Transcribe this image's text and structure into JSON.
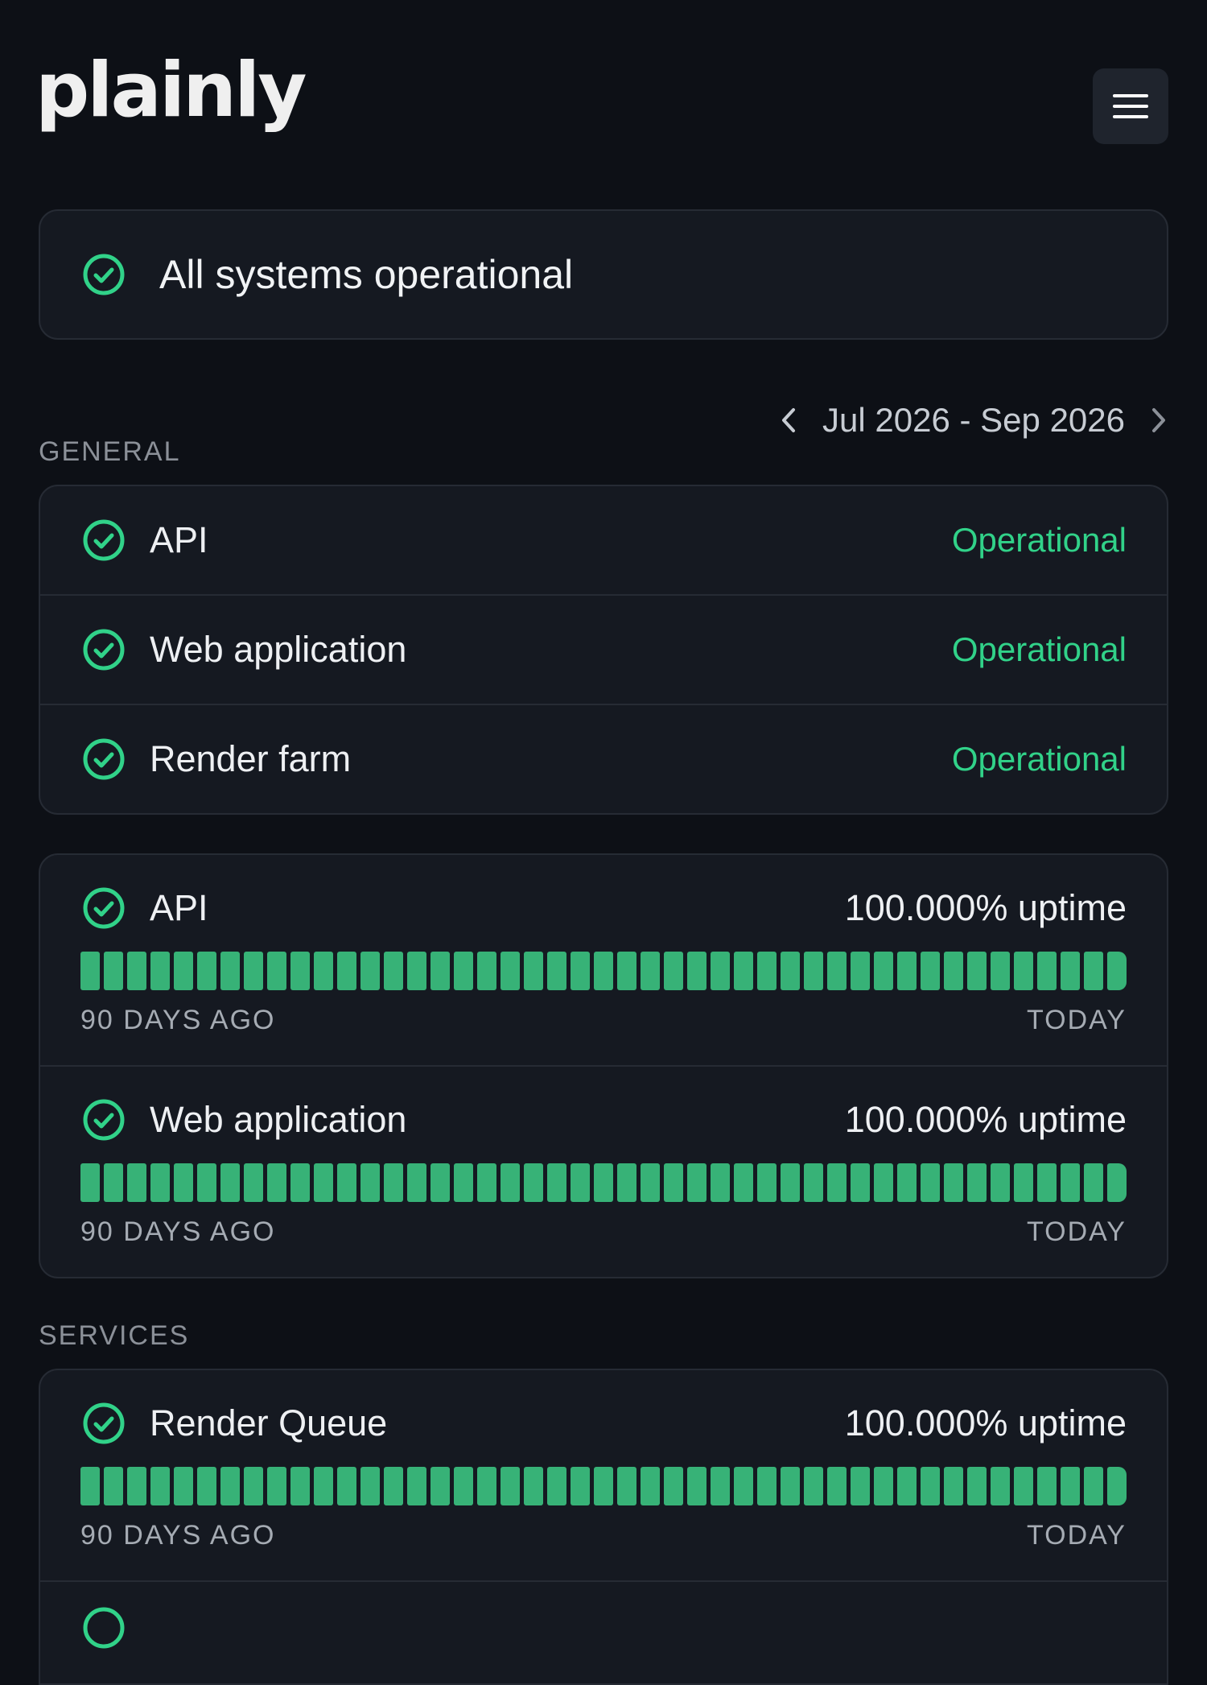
{
  "brand": {
    "logo_text": "plainly"
  },
  "banner": {
    "text": "All systems operational"
  },
  "date_range": {
    "label": "Jul 2026 - Sep 2026"
  },
  "sections": {
    "general_label": "GENERAL",
    "services_label": "SERVICES"
  },
  "general_components": [
    {
      "name": "API",
      "status": "Operational"
    },
    {
      "name": "Web application",
      "status": "Operational"
    },
    {
      "name": "Render farm",
      "status": "Operational"
    }
  ],
  "general_uptime": [
    {
      "name": "API",
      "uptime": "100.000% uptime",
      "start_label": "90 DAYS AGO",
      "end_label": "TODAY"
    },
    {
      "name": "Web application",
      "uptime": "100.000% uptime",
      "start_label": "90 DAYS AGO",
      "end_label": "TODAY"
    }
  ],
  "services_uptime": [
    {
      "name": "Render Queue",
      "uptime": "100.000% uptime",
      "start_label": "90 DAYS AGO",
      "end_label": "TODAY"
    }
  ],
  "uptime_bar_days": 45,
  "colors": {
    "background": "#0d1016",
    "card": "#151921",
    "border": "#262b34",
    "operational_green": "#31d289",
    "bar_green": "#37b277",
    "muted_text": "#8b9098"
  },
  "icons": {
    "status": "check-circle-icon",
    "menu": "hamburger-menu-icon",
    "prev": "chevron-left-icon",
    "next": "chevron-right-icon"
  }
}
